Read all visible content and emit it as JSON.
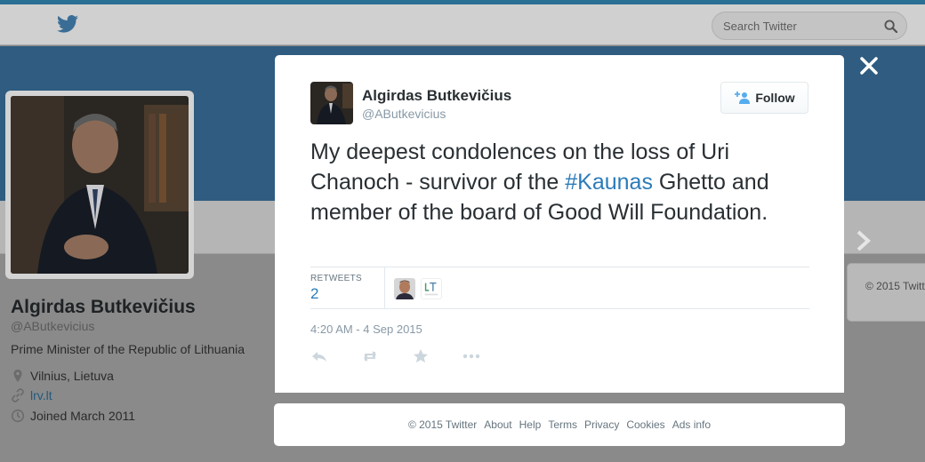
{
  "search": {
    "placeholder": "Search Twitter"
  },
  "profile": {
    "name": "Algirdas Butkevičius",
    "handle": "@AButkevicius",
    "bio": "Prime Minister of the Republic of Lithuania",
    "location": "Vilnius, Lietuva",
    "website": "lrv.lt",
    "joined": "Joined March 2011"
  },
  "right_card": {
    "text": "© 2015 Twitt"
  },
  "tweet": {
    "author_name": "Algirdas Butkevičius",
    "author_handle": "@AButkevicius",
    "follow_label": "Follow",
    "text_before": "My deepest condolences on the loss of Uri Chanoch - survivor of the ",
    "hashtag": "#Kaunas",
    "text_after": " Ghetto and member of the board of Good Will Foundation.",
    "retweets_label": "RETWEETS",
    "retweets_count": "2",
    "timestamp": "4:20 AM - 4 Sep 2015"
  },
  "actions": {
    "icons": [
      "reply-icon",
      "retweet-icon",
      "favorite-icon",
      "more-icon"
    ]
  },
  "footer": {
    "copyright": "© 2015 Twitter",
    "links": [
      "About",
      "Help",
      "Terms",
      "Privacy",
      "Cookies",
      "Ads info"
    ]
  },
  "colors": {
    "link_blue": "#2b7bb9",
    "banner": "#2f5c80",
    "overlay_bg": "#8a8a8a"
  }
}
